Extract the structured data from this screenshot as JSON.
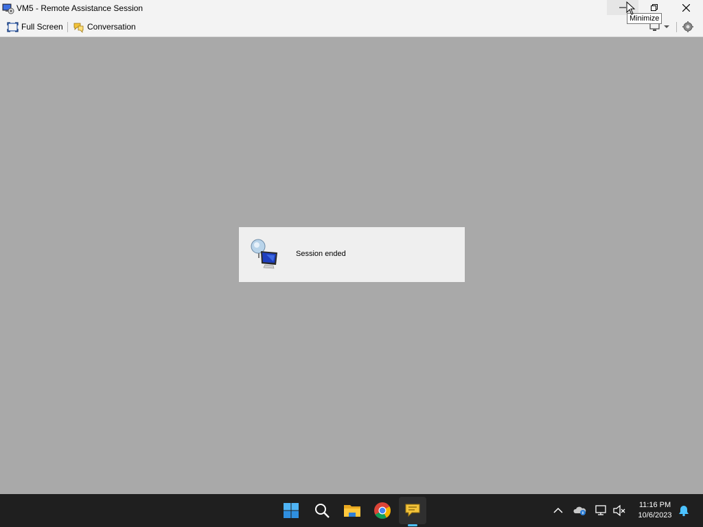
{
  "window": {
    "title": "VM5 - Remote Assistance Session",
    "app_icon": "remote-assistance-icon",
    "controls": {
      "minimize": "minimize-icon",
      "restore": "restore-icon",
      "close": "close-icon"
    },
    "tooltip": "Minimize"
  },
  "toolbar": {
    "full_screen_label": "Full Screen",
    "conversation_label": "Conversation",
    "icons": [
      "full-screen-icon",
      "conversation-icon",
      "monitor-icon",
      "settings-icon"
    ]
  },
  "session": {
    "message": "Session ended",
    "icon": "remote-assistance-computer-icon"
  },
  "taskbar": {
    "apps": [
      "start-icon",
      "search-icon",
      "file-explorer-icon",
      "chrome-icon",
      "remote-assistance-icon"
    ],
    "active_app": "remote-assistance-icon",
    "tray": [
      "show-hidden-icons-chevron",
      "onedrive-icon",
      "network-icon",
      "volume-muted-icon",
      "notifications-icon"
    ],
    "time": "11:16 PM",
    "date": "10/6/2023"
  },
  "colors": {
    "desktop_bg": "#a9a9a9",
    "chrome_bg": "#f3f3f3",
    "panel_bg": "#efefef",
    "taskbar_bg": "#1f1f1f",
    "accent": "#4cc2ff"
  }
}
